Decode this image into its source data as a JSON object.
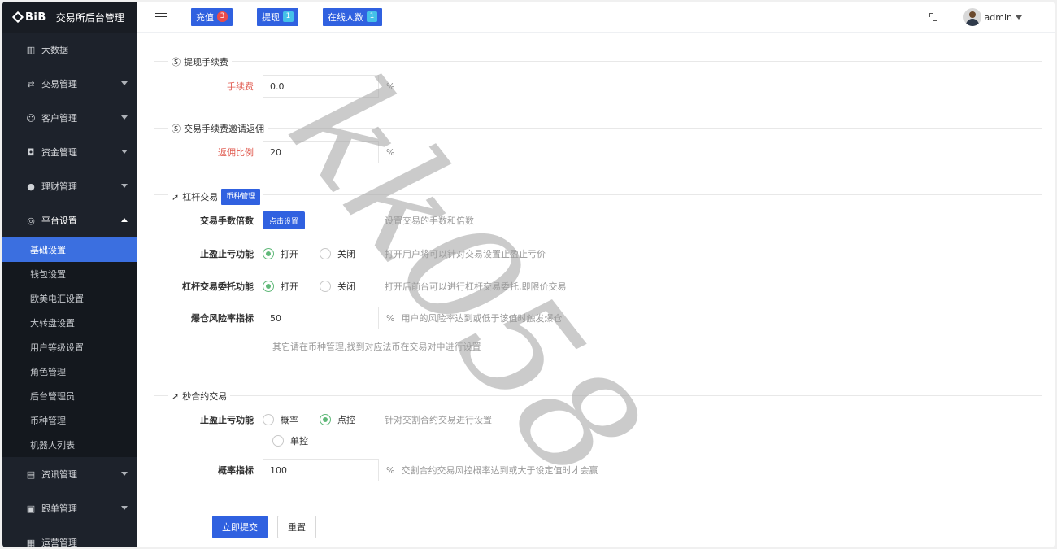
{
  "app": {
    "logo": "BiB",
    "title": "交易所后台管理"
  },
  "sidebar": {
    "items": [
      {
        "label": "大数据",
        "icon": "chart-icon"
      },
      {
        "label": "交易管理",
        "icon": "exchange-icon"
      },
      {
        "label": "客户管理",
        "icon": "users-icon"
      },
      {
        "label": "资金管理",
        "icon": "moneybag-icon"
      },
      {
        "label": "理财管理",
        "icon": "piggy-icon"
      },
      {
        "label": "平台设置",
        "icon": "settings-icon"
      }
    ],
    "sub_items": [
      "基础设置",
      "钱包设置",
      "欧美电汇设置",
      "大转盘设置",
      "用户等级设置",
      "角色管理",
      "后台管理员",
      "币种管理",
      "机器人列表"
    ],
    "items_after": [
      {
        "label": "资讯管理",
        "icon": "news-icon"
      },
      {
        "label": "跟单管理",
        "icon": "follow-icon"
      },
      {
        "label": "运营管理",
        "icon": "ops-icon"
      }
    ]
  },
  "topbar": {
    "buttons": [
      {
        "label": "充值",
        "badge": "3"
      },
      {
        "label": "提现",
        "badge": "1"
      },
      {
        "label": "在线人数",
        "badge": "1"
      }
    ],
    "user": "admin"
  },
  "sections": {
    "withdraw_fee": {
      "title": "提现手续费",
      "label": "手续费",
      "value": "0.0",
      "unit": "%"
    },
    "rebate": {
      "title": "交易手续费邀请返佣",
      "label": "返佣比例",
      "value": "20",
      "unit": "%"
    },
    "leverage": {
      "title": "杠杆交易",
      "coin_btn": "币种管理",
      "multiple_label": "交易手数倍数",
      "multiple_btn": "点击设置",
      "multiple_hint": "设置交易的手数和倍数",
      "stop_label": "止盈止亏功能",
      "stop_on": "打开",
      "stop_off": "关闭",
      "stop_hint": "打开用户将可以针对交易设置止盈止亏价",
      "entrust_label": "杠杆交易委托功能",
      "entrust_on": "打开",
      "entrust_off": "关闭",
      "entrust_hint": "打开后前台可以进行杠杆交易委托,即限价交易",
      "risk_label": "爆仓风险率指标",
      "risk_value": "50",
      "risk_unit": "%",
      "risk_hint": "用户的风险率达到或低于该值时触发爆仓",
      "note": "其它请在币种管理,找到对应法币在交易对中进行设置"
    },
    "second": {
      "title": "秒合约交易",
      "stop_label": "止盈止亏功能",
      "opt1": "概率",
      "opt2": "点控",
      "opt3": "单控",
      "hint": "针对交割合约交易进行设置",
      "prob_label": "概率指标",
      "prob_value": "100",
      "prob_unit": "%",
      "prob_hint": "交割合约交易风控概率达到或大于设定值时才会赢"
    }
  },
  "actions": {
    "submit": "立即提交",
    "reset": "重置"
  },
  "watermark": "kk058"
}
